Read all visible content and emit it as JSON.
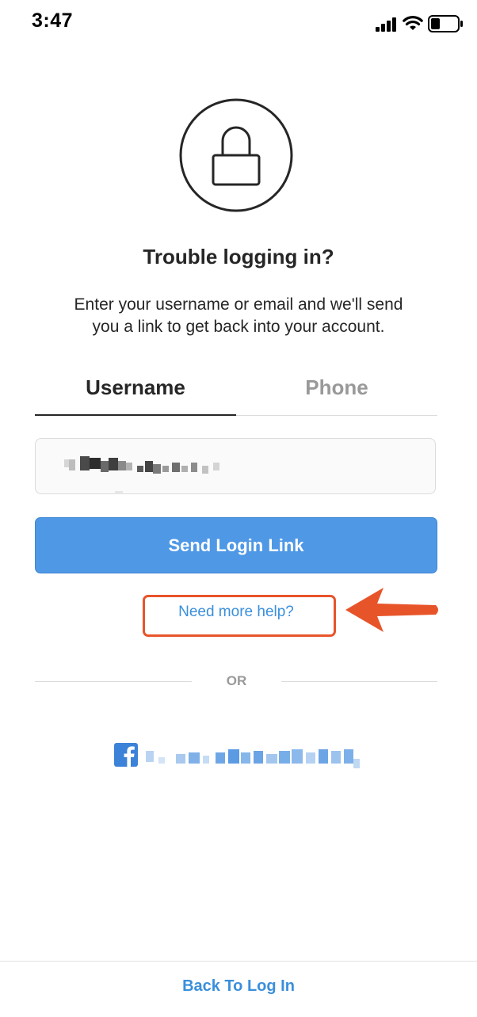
{
  "status_bar": {
    "time": "3:47",
    "icons": [
      "signal-icon",
      "wifi-icon",
      "battery-icon"
    ]
  },
  "main": {
    "icon": "lock-icon",
    "title": "Trouble logging in?",
    "subtitle": "Enter your username or email and we'll send you a link to get back into your account.",
    "tabs": [
      {
        "label": "Username",
        "selected": true
      },
      {
        "label": "Phone",
        "selected": false
      }
    ],
    "send_button_label": "Send Login Link",
    "help_link_label": "Need more help?",
    "divider_label": "OR",
    "facebook_icon": "facebook-icon"
  },
  "footer": {
    "back_link_label": "Back To Log In"
  },
  "colors": {
    "primary_blue": "#4e98e6",
    "link_blue": "#3a8fdc",
    "annotation_orange": "#e8542a",
    "text_dark": "#262626",
    "text_muted": "#999999"
  }
}
